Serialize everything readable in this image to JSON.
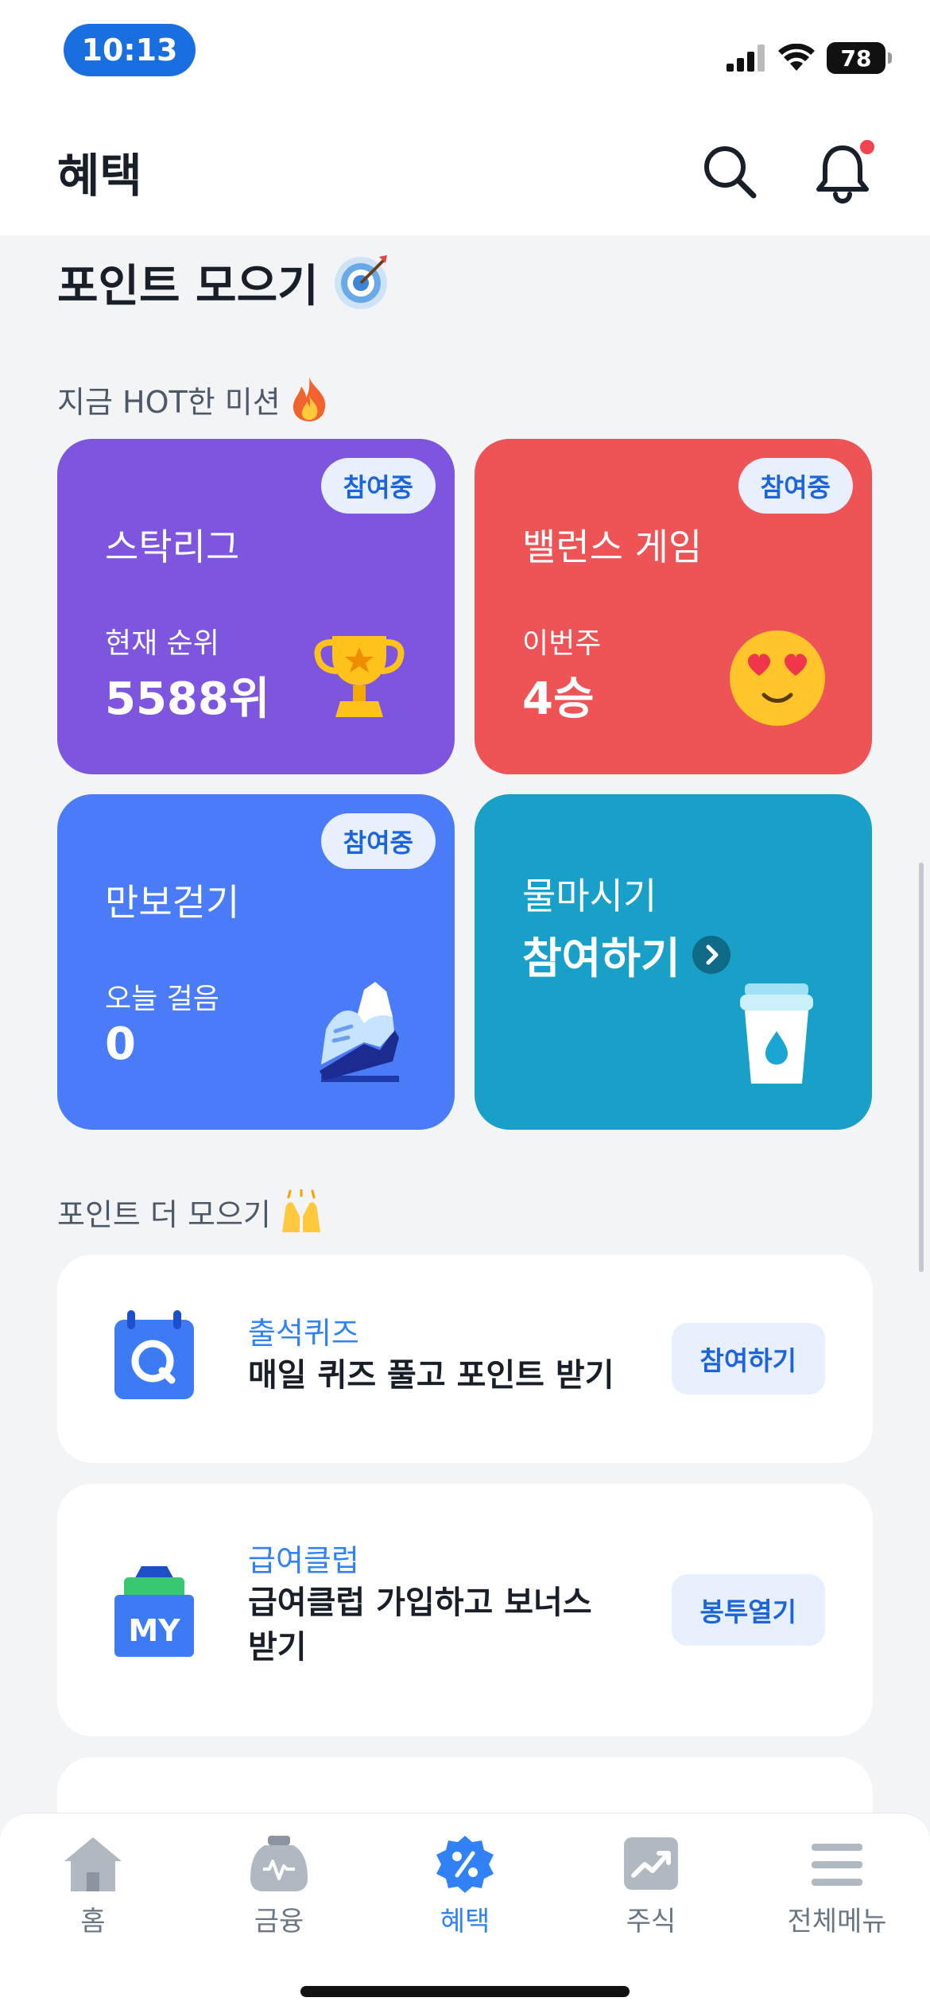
{
  "status_bar": {
    "time": "10:13",
    "battery": "78"
  },
  "header": {
    "title": "혜택"
  },
  "section": {
    "title": "포인트 모으기"
  },
  "hot_missions": {
    "title": "지금 HOT한 미션",
    "cards": [
      {
        "badge": "참여중",
        "title": "스탁리그",
        "label": "현재 순위",
        "value": "5588위",
        "color": "#7e55de"
      },
      {
        "badge": "참여중",
        "title": "밸런스 게임",
        "label": "이번주",
        "value": "4승",
        "color": "#ee5355"
      },
      {
        "badge": "참여중",
        "title": "만보걷기",
        "label": "오늘 걸음",
        "value": "0",
        "color": "#4a7cf7"
      },
      {
        "title": "물마시기",
        "value": "참여하기",
        "color": "#18a0c8"
      }
    ]
  },
  "more_points": {
    "title": "포인트 더 모으기",
    "items": [
      {
        "kicker": "출석퀴즈",
        "text": "매일 퀴즈 풀고 포인트 받기",
        "button": "참여하기"
      },
      {
        "kicker": "급여클럽",
        "text": "급여클럽 가입하고 보너스 받기",
        "button": "봉투열기",
        "icon_text": "MY"
      }
    ]
  },
  "tab_bar": {
    "tabs": [
      {
        "label": "홈",
        "icon": "home-icon"
      },
      {
        "label": "금융",
        "icon": "wallet-icon"
      },
      {
        "label": "혜택",
        "icon": "benefit-icon",
        "active": true
      },
      {
        "label": "주식",
        "icon": "chart-icon"
      },
      {
        "label": "전체메뉴",
        "icon": "menu-icon"
      }
    ]
  },
  "colors": {
    "accent": "#3182f6",
    "badge_bg": "#e8f0fe",
    "background": "#f2f4f6"
  }
}
